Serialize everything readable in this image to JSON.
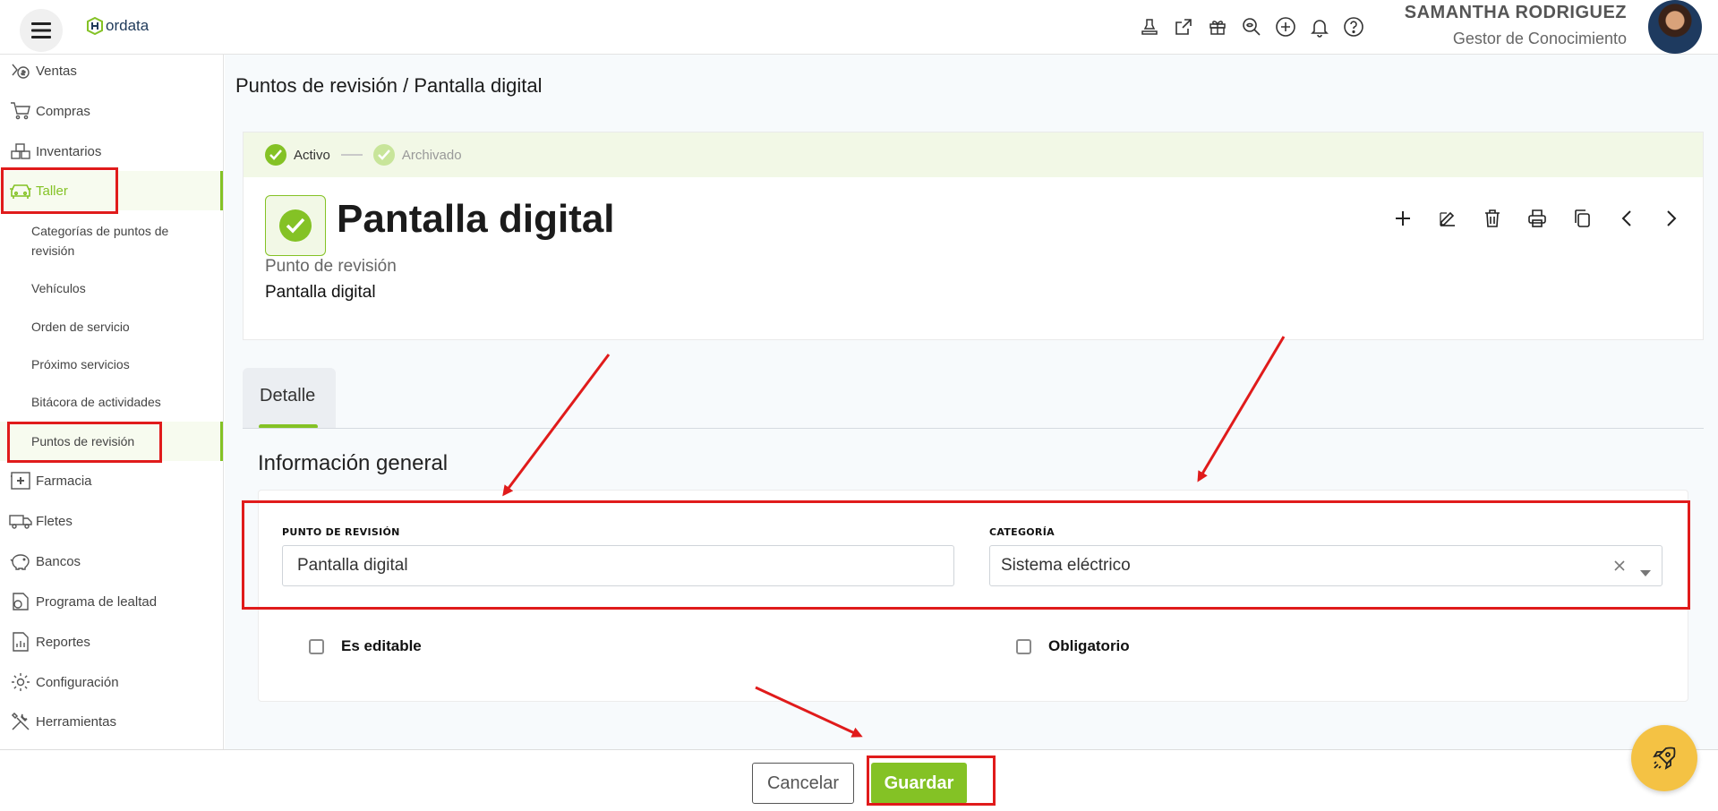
{
  "header": {
    "logo_text": "ordata",
    "user_name": "SAMANTHA RODRIGUEZ",
    "user_role": "Gestor de Conocimiento",
    "icons": [
      "stamp-icon",
      "external-link-icon",
      "gift-icon",
      "zoom-search-icon",
      "add-circle-icon",
      "bell-icon",
      "help-icon"
    ]
  },
  "sidebar": {
    "items": [
      {
        "label": "Ventas",
        "icon": "sales-icon"
      },
      {
        "label": "Compras",
        "icon": "cart-icon"
      },
      {
        "label": "Inventarios",
        "icon": "boxes-icon"
      },
      {
        "label": "Taller",
        "icon": "car-icon"
      },
      {
        "label": "Farmacia",
        "icon": "pharmacy-icon"
      },
      {
        "label": "Fletes",
        "icon": "truck-icon"
      },
      {
        "label": "Bancos",
        "icon": "piggy-bank-icon"
      },
      {
        "label": "Programa de lealtad",
        "icon": "loyalty-icon"
      },
      {
        "label": "Reportes",
        "icon": "report-icon"
      },
      {
        "label": "Configuración",
        "icon": "gear-icon"
      },
      {
        "label": "Herramientas",
        "icon": "tools-icon"
      }
    ],
    "sub_items": [
      "Categorías de puntos de revisión",
      "Vehículos",
      "Orden de servicio",
      "Próximo servicios",
      "Bitácora de actividades",
      "Puntos de revisión"
    ]
  },
  "breadcrumb": {
    "parent": "Puntos de revisión",
    "separator": "/",
    "current": "Pantalla digital"
  },
  "status": {
    "active": "Activo",
    "archived": "Archivado"
  },
  "record": {
    "title": "Pantalla digital",
    "type_label": "Punto de revisión",
    "type_value": "Pantalla digital"
  },
  "toolbar_icons": [
    "plus-icon",
    "edit-icon",
    "trash-icon",
    "print-icon",
    "copy-icon",
    "chevron-left-icon",
    "chevron-right-icon"
  ],
  "tabs": [
    {
      "label": "Detalle"
    }
  ],
  "section": {
    "title": "Información general"
  },
  "form": {
    "point_label": "Punto de revisión",
    "point_value": "Pantalla digital",
    "category_label": "Categoría",
    "category_value": "Sistema eléctrico",
    "editable_label": "Es editable",
    "required_label": "Obligatorio"
  },
  "footer": {
    "cancel": "Cancelar",
    "save": "Guardar"
  },
  "colors": {
    "accent": "#84c225",
    "annotation": "#e01b1b",
    "fab": "#f4c244"
  }
}
